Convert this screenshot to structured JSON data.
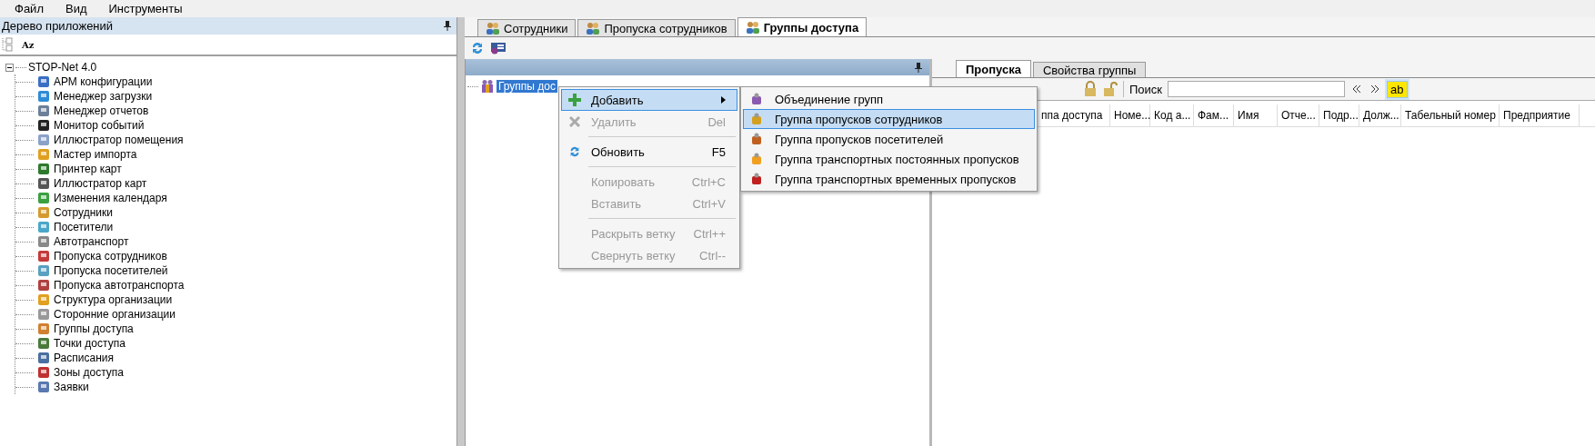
{
  "menu_bar": [
    "Файл",
    "Вид",
    "Инструменты"
  ],
  "app_tree_panel": {
    "title": "Дерево приложений",
    "sort_label": "Az",
    "tree": {
      "label": "STOP-Net 4.0",
      "expanded": true,
      "children": [
        {
          "label": "АРМ конфигурации"
        },
        {
          "label": "Менеджер загрузки"
        },
        {
          "label": "Менеджер отчетов"
        },
        {
          "label": "Монитор событий"
        },
        {
          "label": "Иллюстратор помещения"
        },
        {
          "label": "Мастер импорта"
        },
        {
          "label": "Принтер карт"
        },
        {
          "label": "Иллюстратор карт"
        },
        {
          "label": "Изменения календаря"
        },
        {
          "label": "Сотрудники"
        },
        {
          "label": "Посетители"
        },
        {
          "label": "Автотранспорт"
        },
        {
          "label": "Пропуска сотрудников"
        },
        {
          "label": "Пропуска посетителей"
        },
        {
          "label": "Пропуска автотранспорта"
        },
        {
          "label": "Структура организации"
        },
        {
          "label": "Сторонние организации"
        },
        {
          "label": "Группы доступа"
        },
        {
          "label": "Точки доступа"
        },
        {
          "label": "Расписания"
        },
        {
          "label": "Зоны доступа"
        },
        {
          "label": "Заявки"
        }
      ]
    }
  },
  "document_tabs": [
    {
      "label": "Сотрудники",
      "selected": false
    },
    {
      "label": "Пропуска сотрудников",
      "selected": false
    },
    {
      "label": "Группы доступа",
      "selected": true
    }
  ],
  "groups_tree": {
    "node": {
      "label": "Группы дос",
      "selected": true
    }
  },
  "context_menu": [
    {
      "kind": "item",
      "label": "Добавить",
      "disabled": false,
      "selected": true,
      "submenu": true
    },
    {
      "kind": "item",
      "label": "Удалить",
      "shortcut": "Del",
      "disabled": true,
      "selected": false,
      "submenu": false
    },
    {
      "kind": "separator"
    },
    {
      "kind": "item",
      "label": "Обновить",
      "shortcut": "F5",
      "disabled": false,
      "selected": false,
      "submenu": false
    },
    {
      "kind": "separator"
    },
    {
      "kind": "item",
      "label": "Копировать",
      "shortcut": "Ctrl+C",
      "disabled": true,
      "selected": false,
      "submenu": false
    },
    {
      "kind": "item",
      "label": "Вставить",
      "shortcut": "Ctrl+V",
      "disabled": true,
      "selected": false,
      "submenu": false
    },
    {
      "kind": "separator"
    },
    {
      "kind": "item",
      "label": "Раскрыть ветку",
      "shortcut": "Ctrl++",
      "disabled": true,
      "selected": false,
      "submenu": false
    },
    {
      "kind": "item",
      "label": "Свернуть ветку",
      "shortcut": "Ctrl--",
      "disabled": true,
      "selected": false,
      "submenu": false
    }
  ],
  "submenu": [
    {
      "label": "Объединение групп",
      "selected": false
    },
    {
      "label": "Группа пропусков сотрудников",
      "selected": true
    },
    {
      "label": "Группа пропусков посетителей",
      "selected": false
    },
    {
      "label": "Группа транспортных постоянных пропусков",
      "selected": false
    },
    {
      "label": "Группа транспортных временных пропусков",
      "selected": false
    }
  ],
  "group_detail": {
    "tabs": [
      {
        "label": "Пропуска",
        "selected": true
      },
      {
        "label": "Свойства группы",
        "selected": false
      }
    ],
    "search_label": "Поиск",
    "highlight_on": true,
    "highlight_label": "ab",
    "columns": [
      "ппа доступа",
      "Номе...",
      "Код а...",
      "Фам...",
      "Имя",
      "Отче...",
      "Подр...",
      "Долж...",
      "Табельный номер",
      "Предприятие"
    ]
  }
}
